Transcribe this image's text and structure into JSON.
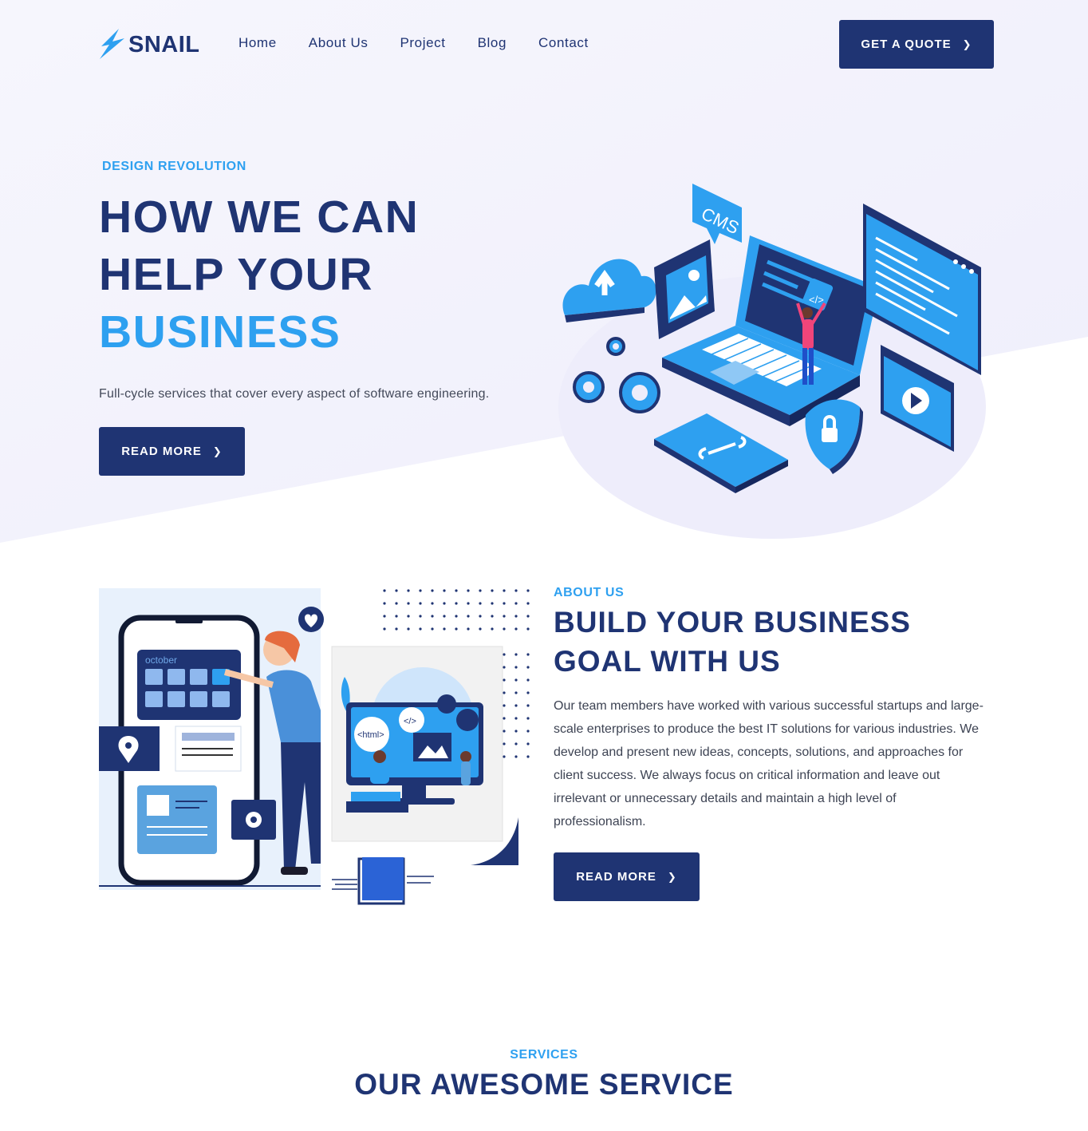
{
  "colors": {
    "navy": "#1f3473",
    "accent_blue": "#2ea0f0",
    "hero_bg": "#f1f0fc"
  },
  "header": {
    "logo_text": "SNAIL",
    "nav": [
      "Home",
      "About Us",
      "Project",
      "Blog",
      "Contact"
    ],
    "cta_label": "GET A QUOTE",
    "cta_icon": "chevron-right-icon"
  },
  "hero": {
    "eyebrow": "DESIGN REVOLUTION",
    "title_line1": "HOW WE CAN",
    "title_line2": "HELP YOUR",
    "title_line3": "BUSINESS",
    "subtitle": "Full-cycle services that cover every aspect of software engineering.",
    "button_label": "READ MORE",
    "illustration": {
      "cms_label": "CMS",
      "code_label": "</>",
      "icons": [
        "cloud-upload-icon",
        "image-icon",
        "gear-icon",
        "shield-lock-icon",
        "play-icon",
        "code-brackets-icon"
      ]
    }
  },
  "about": {
    "eyebrow": "ABOUT US",
    "title_line1": "BUILD YOUR BUSINESS",
    "title_line2": "GOAL WITH US",
    "body": "Our team members have worked with various successful startups and large-scale enterprises to produce the best IT solutions for various industries. We develop and present new ideas, concepts, solutions, and approaches for client success. We always focus on critical information and leave out irrelevant or unnecessary details and maintain a high level of professionalism.",
    "button_label": "READ MORE",
    "illustration": {
      "calendar_label": "october",
      "html_label": "<html>",
      "code_label": "</>",
      "icons": [
        "location-pin-icon",
        "gear-icon",
        "heart-icon"
      ]
    }
  },
  "services": {
    "eyebrow": "SERVICES",
    "title": "OUR AWESOME SERVICE"
  }
}
